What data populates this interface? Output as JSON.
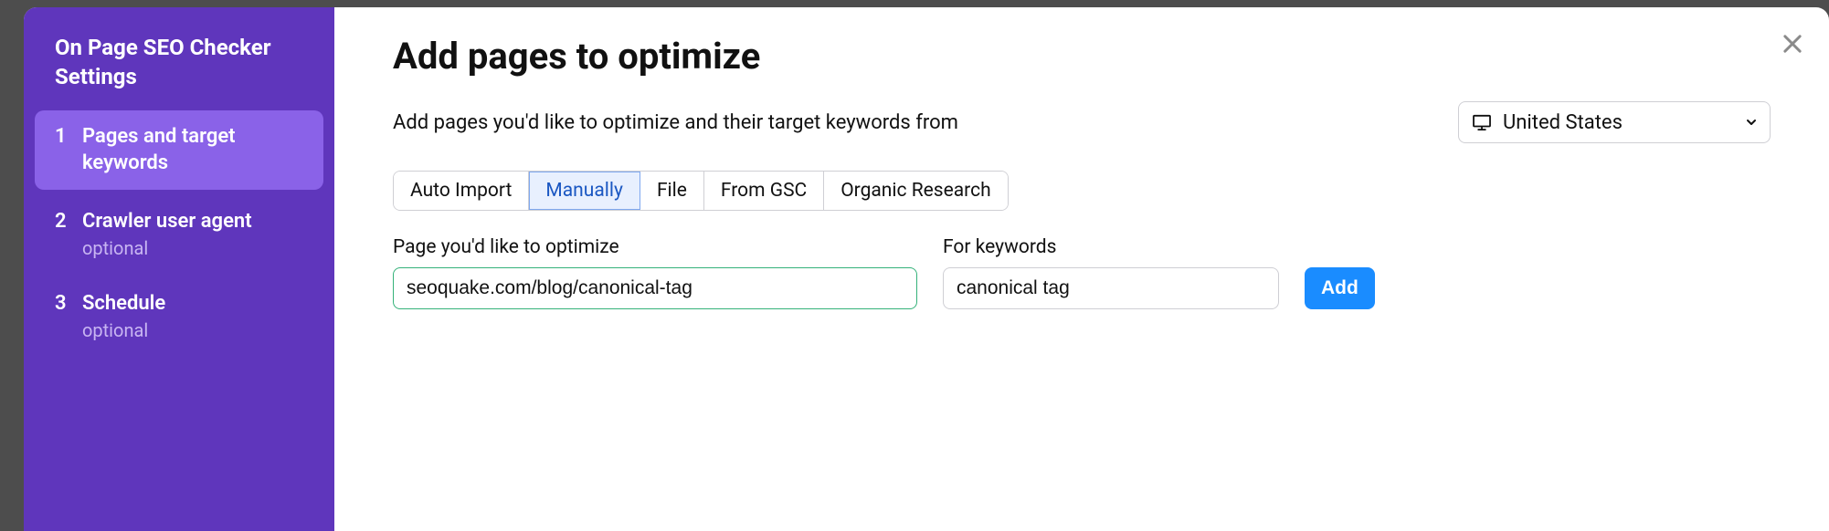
{
  "sidebar": {
    "title": "On Page SEO Checker Settings",
    "steps": [
      {
        "index": "1",
        "label": "Pages and target keywords",
        "optional": ""
      },
      {
        "index": "2",
        "label": "Crawler user agent",
        "optional": "optional"
      },
      {
        "index": "3",
        "label": "Schedule",
        "optional": "optional"
      }
    ]
  },
  "main": {
    "title": "Add pages to optimize",
    "subtitle": "Add pages you'd like to optimize and their target keywords from",
    "country": "United States",
    "tabs": [
      "Auto Import",
      "Manually",
      "File",
      "From GSC",
      "Organic Research"
    ],
    "active_tab_index": 1,
    "page_label": "Page you'd like to optimize",
    "page_value": "seoquake.com/blog/canonical-tag",
    "keywords_label": "For keywords",
    "keywords_value": "canonical tag",
    "add_label": "Add"
  }
}
